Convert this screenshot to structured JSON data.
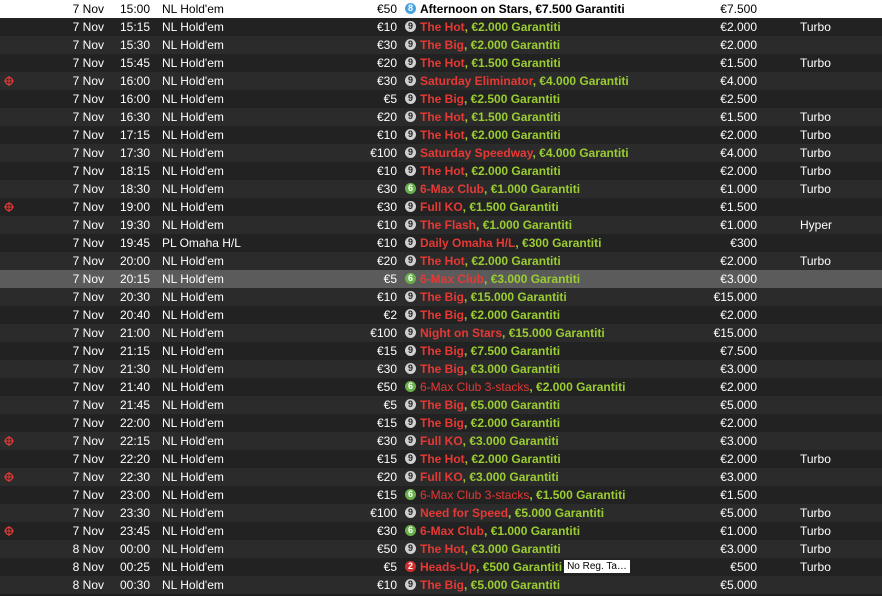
{
  "colors": {
    "name_red": "#e53935",
    "guarantee_green": "#9acd32",
    "row_dark": "#222222",
    "row_mid": "#2b2b2b",
    "selected": "#5b5b5b"
  },
  "rows": [
    {
      "icon": "",
      "date": "7 Nov",
      "time": "15:00",
      "game": "NL Hold'em",
      "buyin": "€50",
      "badge": "8",
      "name": "Afternoon on Stars",
      "gtd": "€7.500 Garantiti",
      "prize": "€7.500",
      "speed": "",
      "note": ""
    },
    {
      "icon": "",
      "date": "7 Nov",
      "time": "15:15",
      "game": "NL Hold'em",
      "buyin": "€10",
      "badge": "9",
      "name": "The Hot",
      "gtd": "€2.000 Garantiti",
      "prize": "€2.000",
      "speed": "Turbo",
      "note": ""
    },
    {
      "icon": "",
      "date": "7 Nov",
      "time": "15:30",
      "game": "NL Hold'em",
      "buyin": "€30",
      "badge": "9",
      "name": "The Big",
      "gtd": "€2.000 Garantiti",
      "prize": "€2.000",
      "speed": "",
      "note": ""
    },
    {
      "icon": "",
      "date": "7 Nov",
      "time": "15:45",
      "game": "NL Hold'em",
      "buyin": "€20",
      "badge": "9",
      "name": "The Hot",
      "gtd": "€1.500 Garantiti",
      "prize": "€1.500",
      "speed": "Turbo",
      "note": ""
    },
    {
      "icon": "crosshair-icon",
      "date": "7 Nov",
      "time": "16:00",
      "game": "NL Hold'em",
      "buyin": "€30",
      "badge": "9",
      "name": "Saturday Eliminator",
      "gtd": "€4.000 Garantiti",
      "prize": "€4.000",
      "speed": "",
      "note": ""
    },
    {
      "icon": "",
      "date": "7 Nov",
      "time": "16:00",
      "game": "NL Hold'em",
      "buyin": "€5",
      "badge": "9",
      "name": "The Big",
      "gtd": "€2.500 Garantiti",
      "prize": "€2.500",
      "speed": "",
      "note": ""
    },
    {
      "icon": "",
      "date": "7 Nov",
      "time": "16:30",
      "game": "NL Hold'em",
      "buyin": "€20",
      "badge": "9",
      "name": "The Hot",
      "gtd": "€1.500 Garantiti",
      "prize": "€1.500",
      "speed": "Turbo",
      "note": ""
    },
    {
      "icon": "",
      "date": "7 Nov",
      "time": "17:15",
      "game": "NL Hold'em",
      "buyin": "€10",
      "badge": "9",
      "name": "The Hot",
      "gtd": "€2.000 Garantiti",
      "prize": "€2.000",
      "speed": "Turbo",
      "note": ""
    },
    {
      "icon": "",
      "date": "7 Nov",
      "time": "17:30",
      "game": "NL Hold'em",
      "buyin": "€100",
      "badge": "9",
      "name": "Saturday Speedway",
      "gtd": "€4.000 Garantiti",
      "prize": "€4.000",
      "speed": "Turbo",
      "note": ""
    },
    {
      "icon": "",
      "date": "7 Nov",
      "time": "18:15",
      "game": "NL Hold'em",
      "buyin": "€10",
      "badge": "9",
      "name": "The Hot",
      "gtd": "€2.000 Garantiti",
      "prize": "€2.000",
      "speed": "Turbo",
      "note": ""
    },
    {
      "icon": "",
      "date": "7 Nov",
      "time": "18:30",
      "game": "NL Hold'em",
      "buyin": "€30",
      "badge": "6",
      "name": "6-Max Club",
      "gtd": "€1.000 Garantiti",
      "prize": "€1.000",
      "speed": "Turbo",
      "note": ""
    },
    {
      "icon": "crosshair-icon",
      "date": "7 Nov",
      "time": "19:00",
      "game": "NL Hold'em",
      "buyin": "€30",
      "badge": "9",
      "name": "Full KO",
      "gtd": "€1.500 Garantiti",
      "prize": "€1.500",
      "speed": "",
      "note": ""
    },
    {
      "icon": "",
      "date": "7 Nov",
      "time": "19:30",
      "game": "NL Hold'em",
      "buyin": "€10",
      "badge": "9",
      "name": "The Flash",
      "gtd": "€1.000 Garantiti",
      "prize": "€1.000",
      "speed": "Hyper",
      "note": ""
    },
    {
      "icon": "",
      "date": "7 Nov",
      "time": "19:45",
      "game": "PL Omaha H/L",
      "buyin": "€10",
      "badge": "9",
      "name": "Daily Omaha H/L",
      "gtd": "€300 Garantiti",
      "prize": "€300",
      "speed": "",
      "note": ""
    },
    {
      "icon": "",
      "date": "7 Nov",
      "time": "20:00",
      "game": "NL Hold'em",
      "buyin": "€20",
      "badge": "9",
      "name": "The Hot",
      "gtd": "€2.000 Garantiti",
      "prize": "€2.000",
      "speed": "Turbo",
      "note": ""
    },
    {
      "icon": "",
      "date": "7 Nov",
      "time": "20:15",
      "game": "NL Hold'em",
      "buyin": "€5",
      "badge": "6",
      "name": "6-Max Club",
      "gtd": "€3.000 Garantiti",
      "prize": "€3.000",
      "speed": "",
      "note": "",
      "selected": true
    },
    {
      "icon": "",
      "date": "7 Nov",
      "time": "20:30",
      "game": "NL Hold'em",
      "buyin": "€10",
      "badge": "9",
      "name": "The Big",
      "gtd": "€15.000 Garantiti",
      "prize": "€15.000",
      "speed": "",
      "note": ""
    },
    {
      "icon": "",
      "date": "7 Nov",
      "time": "20:40",
      "game": "NL Hold'em",
      "buyin": "€2",
      "badge": "9",
      "name": "The Big",
      "gtd": "€2.000 Garantiti",
      "prize": "€2.000",
      "speed": "",
      "note": ""
    },
    {
      "icon": "",
      "date": "7 Nov",
      "time": "21:00",
      "game": "NL Hold'em",
      "buyin": "€100",
      "badge": "9",
      "name": "Night on Stars",
      "gtd": "€15.000 Garantiti",
      "prize": "€15.000",
      "speed": "",
      "note": ""
    },
    {
      "icon": "",
      "date": "7 Nov",
      "time": "21:15",
      "game": "NL Hold'em",
      "buyin": "€15",
      "badge": "9",
      "name": "The Big",
      "gtd": "€7.500 Garantiti",
      "prize": "€7.500",
      "speed": "",
      "note": ""
    },
    {
      "icon": "",
      "date": "7 Nov",
      "time": "21:30",
      "game": "NL Hold'em",
      "buyin": "€30",
      "badge": "9",
      "name": "The Big",
      "gtd": "€3.000 Garantiti",
      "prize": "€3.000",
      "speed": "",
      "note": ""
    },
    {
      "icon": "",
      "date": "7 Nov",
      "time": "21:40",
      "game": "NL Hold'em",
      "buyin": "€50",
      "badge": "6",
      "name": "6-Max Club 3-stacks",
      "gtd": "€2.000 Garantiti",
      "prize": "€2.000",
      "speed": "",
      "note": ""
    },
    {
      "icon": "",
      "date": "7 Nov",
      "time": "21:45",
      "game": "NL Hold'em",
      "buyin": "€5",
      "badge": "9",
      "name": "The Big",
      "gtd": "€5.000 Garantiti",
      "prize": "€5.000",
      "speed": "",
      "note": ""
    },
    {
      "icon": "",
      "date": "7 Nov",
      "time": "22:00",
      "game": "NL Hold'em",
      "buyin": "€15",
      "badge": "9",
      "name": "The Big",
      "gtd": "€2.000 Garantiti",
      "prize": "€2.000",
      "speed": "",
      "note": ""
    },
    {
      "icon": "crosshair-icon",
      "date": "7 Nov",
      "time": "22:15",
      "game": "NL Hold'em",
      "buyin": "€30",
      "badge": "9",
      "name": "Full KO",
      "gtd": "€3.000 Garantiti",
      "prize": "€3.000",
      "speed": "",
      "note": ""
    },
    {
      "icon": "",
      "date": "7 Nov",
      "time": "22:20",
      "game": "NL Hold'em",
      "buyin": "€15",
      "badge": "9",
      "name": "The Hot",
      "gtd": "€2.000 Garantiti",
      "prize": "€2.000",
      "speed": "Turbo",
      "note": ""
    },
    {
      "icon": "crosshair-icon",
      "date": "7 Nov",
      "time": "22:30",
      "game": "NL Hold'em",
      "buyin": "€20",
      "badge": "9",
      "name": "Full KO",
      "gtd": "€3.000 Garantiti",
      "prize": "€3.000",
      "speed": "",
      "note": ""
    },
    {
      "icon": "",
      "date": "7 Nov",
      "time": "23:00",
      "game": "NL Hold'em",
      "buyin": "€15",
      "badge": "6",
      "name": "6-Max Club 3-stacks",
      "gtd": "€1.500 Garantiti",
      "prize": "€1.500",
      "speed": "",
      "note": ""
    },
    {
      "icon": "",
      "date": "7 Nov",
      "time": "23:30",
      "game": "NL Hold'em",
      "buyin": "€100",
      "badge": "9",
      "name": "Need for Speed",
      "gtd": "€5.000 Garantiti",
      "prize": "€5.000",
      "speed": "Turbo",
      "note": ""
    },
    {
      "icon": "crosshair-icon",
      "date": "7 Nov",
      "time": "23:45",
      "game": "NL Hold'em",
      "buyin": "€30",
      "badge": "6",
      "name": "6-Max Club",
      "gtd": "€1.000 Garantiti",
      "prize": "€1.000",
      "speed": "Turbo",
      "note": ""
    },
    {
      "icon": "",
      "date": "8 Nov",
      "time": "00:00",
      "game": "NL Hold'em",
      "buyin": "€50",
      "badge": "9",
      "name": "The Hot",
      "gtd": "€3.000 Garantiti",
      "prize": "€3.000",
      "speed": "Turbo",
      "note": ""
    },
    {
      "icon": "",
      "date": "8 Nov",
      "time": "00:25",
      "game": "NL Hold'em",
      "buyin": "€5",
      "badge": "2",
      "name": "Heads-Up",
      "gtd": "€500 Garantiti",
      "prize": "€500",
      "speed": "Turbo",
      "note": "No Reg. Ta…"
    },
    {
      "icon": "",
      "date": "8 Nov",
      "time": "00:30",
      "game": "NL Hold'em",
      "buyin": "€10",
      "badge": "9",
      "name": "The Big",
      "gtd": "€5.000 Garantiti",
      "prize": "€5.000",
      "speed": "",
      "note": ""
    }
  ]
}
